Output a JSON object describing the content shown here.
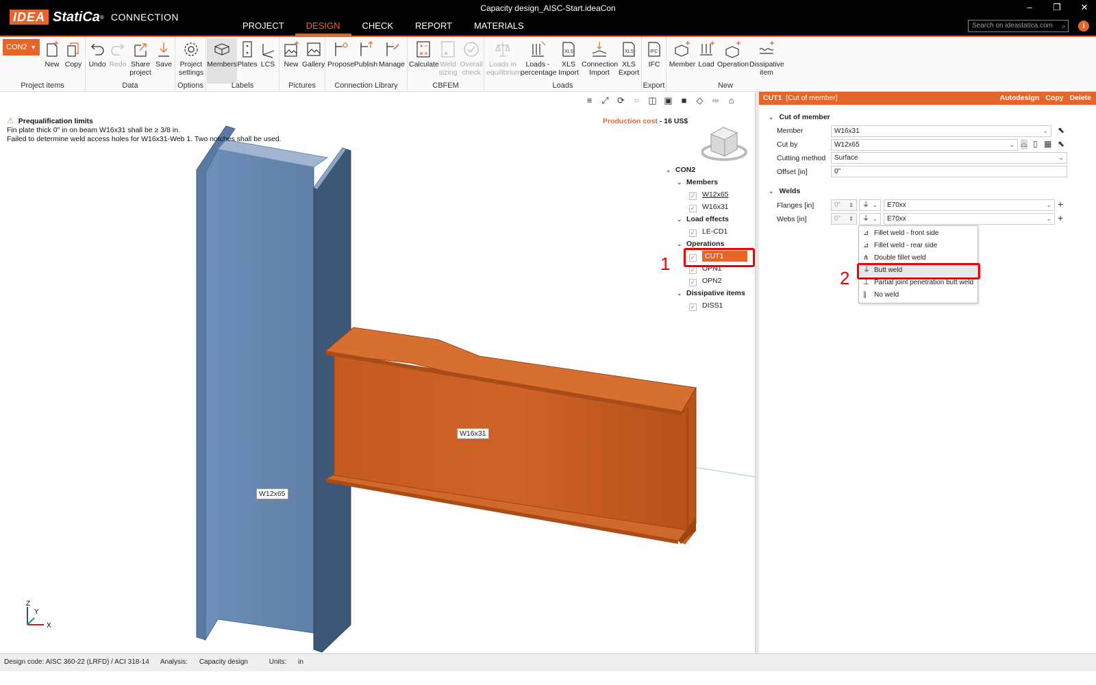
{
  "app": {
    "brand": "IDEA",
    "brand2": "StatiCa",
    "product": "CONNECTION",
    "window_title": "Capacity design_AISC-Start.ideaCon",
    "search_placeholder": "Search on ideastatica.com",
    "main_tabs": [
      "PROJECT",
      "DESIGN",
      "CHECK",
      "REPORT",
      "MATERIALS"
    ],
    "active_tab": "DESIGN",
    "accent": "#e8652a"
  },
  "ribbon": {
    "connection": "CON2",
    "groups": {
      "project_items": {
        "label": "Project items",
        "buttons": [
          "New",
          "Copy"
        ]
      },
      "data": {
        "label": "Data",
        "buttons": [
          "Undo",
          "Redo",
          "Share project",
          "Save"
        ]
      },
      "options": {
        "label": "Options",
        "buttons": [
          "Project settings"
        ]
      },
      "labels": {
        "label": "Labels",
        "buttons": [
          "Members",
          "Plates",
          "LCS"
        ]
      },
      "pictures": {
        "label": "Pictures",
        "buttons": [
          "New",
          "Gallery"
        ]
      },
      "library": {
        "label": "Connection Library",
        "buttons": [
          "Propose",
          "Publish",
          "Manage"
        ]
      },
      "cbfem": {
        "label": "CBFEM",
        "buttons": [
          "Calculate",
          "Weld sizing",
          "Overall check"
        ]
      },
      "loads": {
        "label": "Loads",
        "buttons": [
          "Loads in equilibrium",
          "Loads - percentage",
          "XLS Import",
          "Connection Import",
          "XLS Export"
        ]
      },
      "export": {
        "label": "Export",
        "buttons": [
          "IFC"
        ]
      },
      "new": {
        "label": "New",
        "buttons": [
          "Member",
          "Load",
          "Operation",
          "Dissipative item"
        ]
      }
    }
  },
  "viewport": {
    "warning_title": "Prequalification limits",
    "warning_line1": "Fin plate thick 0\" in on beam W16x31 shall be ≥ 3/8 in.",
    "warning_line2": "Failed to determine weld access holes for W16x31-Web 1. Two notches shall be used.",
    "production_cost_label": "Production cost",
    "production_cost_value": " - 16 US$",
    "column_label": "W12x65",
    "beam_label": "W16x31",
    "annotation_1": "1",
    "annotation_2": "2",
    "axis_z": "Z",
    "axis_y": "Y",
    "axis_x": "X"
  },
  "tree": {
    "root": "CON2",
    "members_title": "Members",
    "members": [
      "W12x65",
      "W16x31"
    ],
    "load_effects_title": "Load effects",
    "load_effects": [
      "LE-CD1"
    ],
    "operations_title": "Operations",
    "operations": [
      "CUT1",
      "OPN1",
      "OPN2"
    ],
    "dissipative_title": "Dissipative items",
    "dissipative": [
      "DISS1"
    ]
  },
  "panel": {
    "title": "CUT1",
    "subtitle": "[Cut of member]",
    "actions": [
      "Autodesign",
      "Copy",
      "Delete"
    ],
    "cut_section": "Cut of member",
    "member_label": "Member",
    "member_value": "W16x31",
    "cut_by_label": "Cut by",
    "cut_by_value": "W12x65",
    "method_label": "Cutting method",
    "method_value": "Surface",
    "offset_label": "Offset [in]",
    "offset_value": "0\"",
    "welds_section": "Welds",
    "flanges_label": "Flanges [in]",
    "flanges_size": "0\"",
    "flanges_material": "E70xx",
    "webs_label": "Webs [in]",
    "webs_size": "0\"",
    "webs_material": "E70xx",
    "weld_options": [
      "Fillet weld - front side",
      "Fillet weld - rear side",
      "Double fillet weld",
      "Butt weld",
      "Partial joint penetration butt weld",
      "No weld"
    ],
    "selected_weld": "Butt weld"
  },
  "status": {
    "design_code": "Design code: AISC 360-22 (LRFD) / ACI 318-14",
    "analysis_label": "Analysis:",
    "analysis_value": "Capacity design",
    "units_label": "Units:",
    "units_value": "in"
  }
}
